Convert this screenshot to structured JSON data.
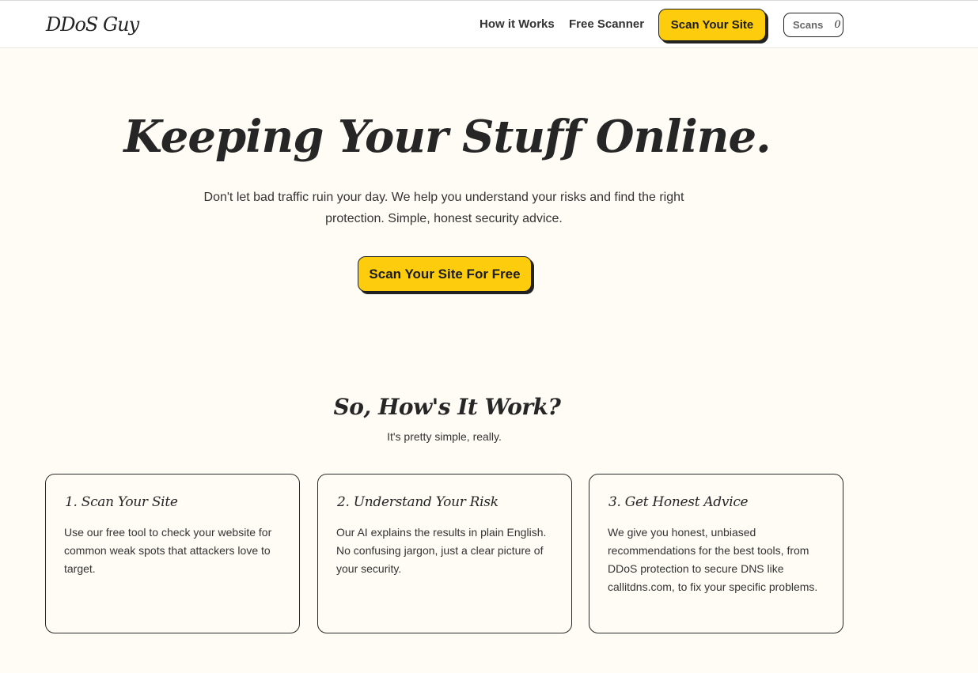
{
  "header": {
    "logo": "DDoS Guy",
    "nav": {
      "how_it_works": "How it Works",
      "free_scanner": "Free Scanner"
    },
    "cta_label": "Scan Your Site",
    "scans_label": "Scans",
    "scans_count": "0"
  },
  "hero": {
    "title": "Keeping Your Stuff Online.",
    "subtitle": "Don't let bad traffic ruin your day. We help you understand your risks and find the right protection. Simple, honest security advice.",
    "cta_label": "Scan Your Site For Free"
  },
  "how": {
    "title": "So, How's It Work?",
    "subtitle": "It's pretty simple, really.",
    "steps": [
      {
        "title": "1. Scan Your Site",
        "body": "Use our free tool to check your website for common weak spots that attackers love to target."
      },
      {
        "title": "2. Understand Your Risk",
        "body": "Our AI explains the results in plain English. No confusing jargon, just a clear picture of your security."
      },
      {
        "title": "3. Get Honest Advice",
        "body": "We give you honest, unbiased recommendations for the best tools, from DDoS protection to secure DNS like callitdns.com, to fix your specific problems."
      }
    ]
  },
  "colors": {
    "background": "#fefcf4",
    "accent": "#fdcc0d",
    "text": "#2a2a2a"
  }
}
